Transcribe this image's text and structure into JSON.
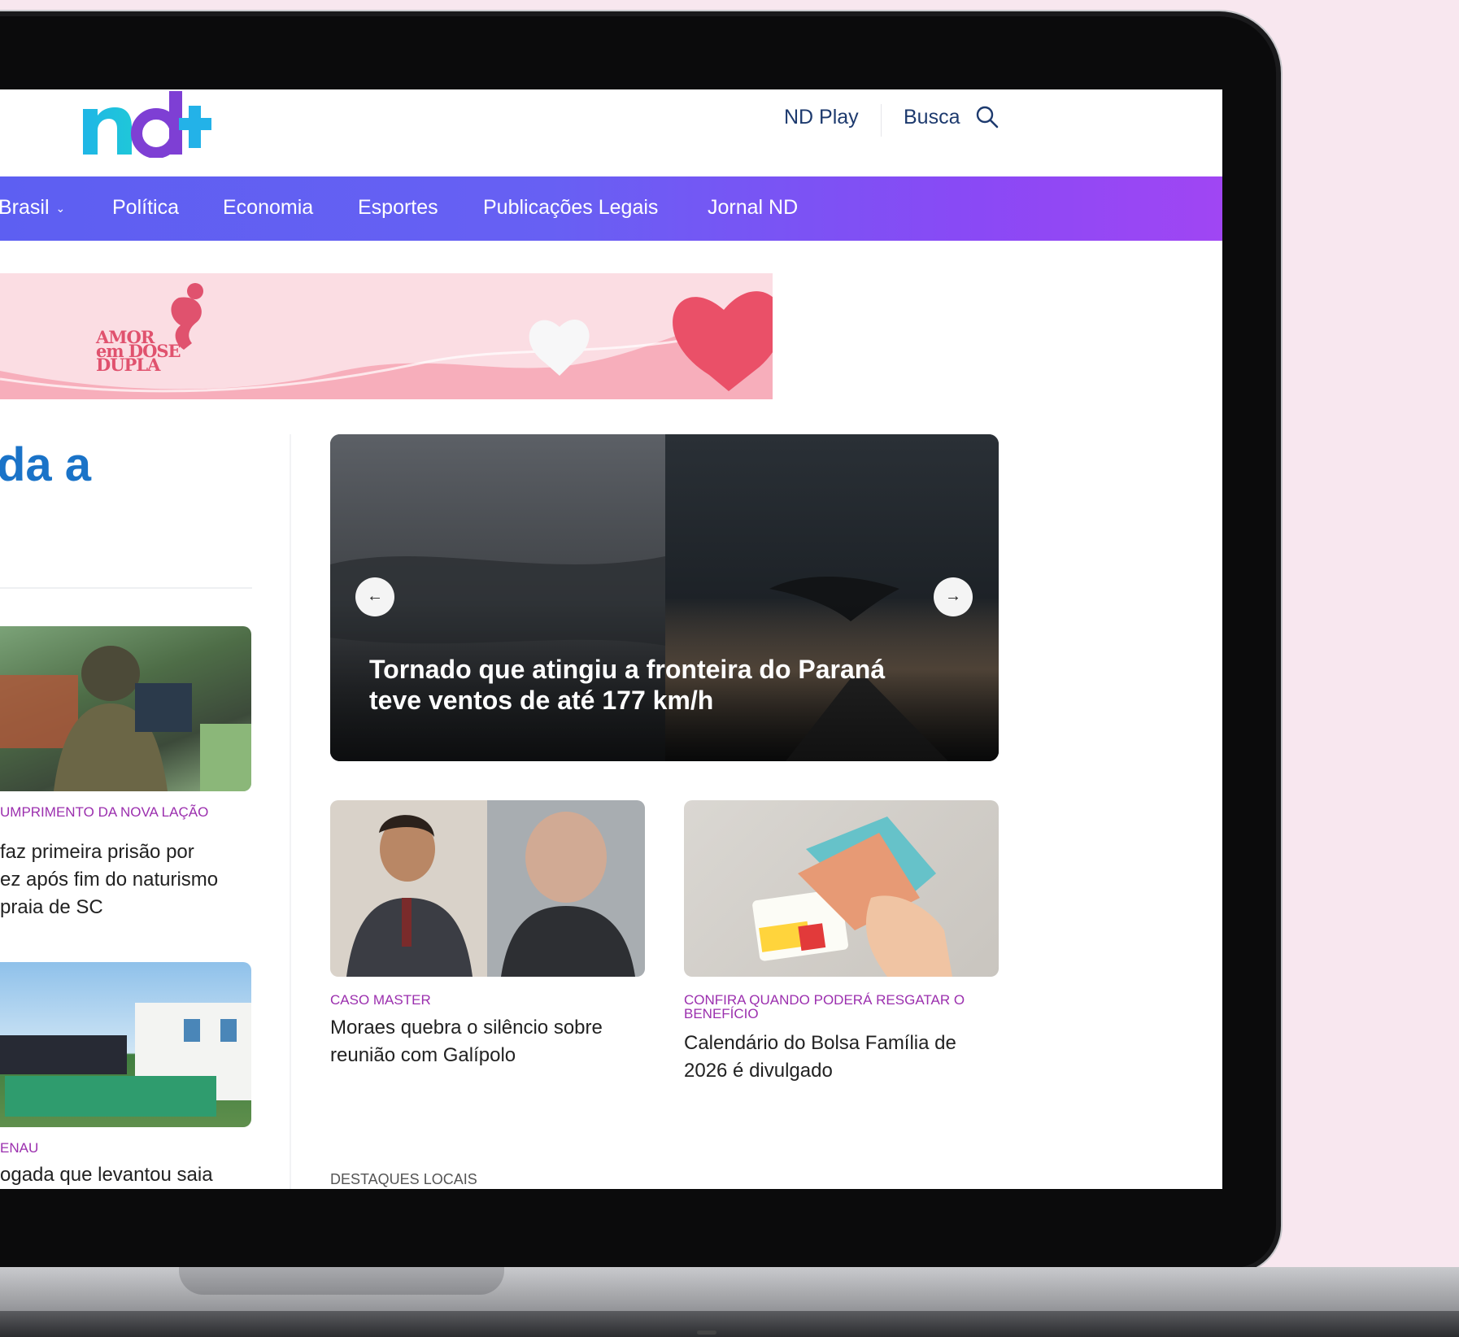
{
  "header": {
    "logo_text": "nd+",
    "nd_play": "ND Play",
    "search": "Busca"
  },
  "nav": {
    "items": [
      {
        "label": "Brasil"
      },
      {
        "label": "Política"
      },
      {
        "label": "Economia"
      },
      {
        "label": "Esportes"
      },
      {
        "label": "Publicações Legais"
      },
      {
        "label": "Jornal ND"
      }
    ]
  },
  "banner": {
    "logo_lines": [
      "AMOR",
      "em DOSE",
      "DUPLA"
    ]
  },
  "left_column": {
    "headline_fragment": "da a",
    "cards": [
      {
        "kicker": "UMPRIMENTO DA NOVA LAÇÃO",
        "title_lines": [
          "faz primeira prisão por",
          "ez após fim do naturismo",
          "praia de SC"
        ]
      },
      {
        "kicker": "ENAU",
        "title_lines": [
          "ogada que levantou saia"
        ]
      }
    ]
  },
  "hero": {
    "title": "Tornado que atingiu a fronteira do Paraná teve ventos de até 177 km/h",
    "prev_label": "←",
    "next_label": "→"
  },
  "grid": [
    {
      "kicker": "CASO MASTER",
      "title": "Moraes quebra o silêncio sobre reunião com Galípolo"
    },
    {
      "kicker": "CONFIRA QUANDO PODERÁ RESGATAR O BENEFÍCIO",
      "title": "Calendário do Bolsa Família de 2026 é divulgado"
    }
  ],
  "section_label": "DESTAQUES LOCAIS",
  "colors": {
    "background": "#f8e7ef",
    "nav_start": "#5d5ff2",
    "nav_end": "#a046f3",
    "kicker": "#9b2fae",
    "headline": "#1a73c8",
    "top_link": "#1d3a6e"
  }
}
